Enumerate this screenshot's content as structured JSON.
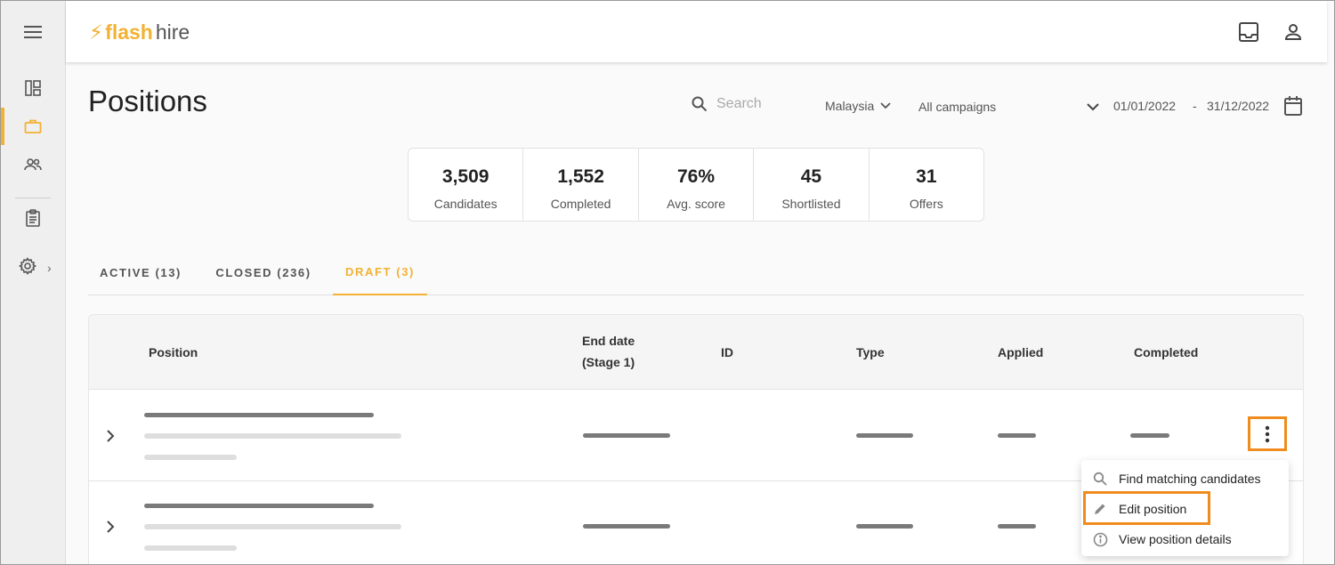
{
  "brand": {
    "bolt": "⚡",
    "flash": "flash",
    "hire": "hire",
    "accent": "#f2b233"
  },
  "sidebar": {
    "icons": [
      "menu-icon",
      "dashboard-icon",
      "briefcase-icon",
      "people-icon",
      "clipboard-icon",
      "gear-icon"
    ]
  },
  "topbar": {
    "icons": [
      "inbox-icon",
      "user-icon"
    ]
  },
  "page": {
    "title": "Positions"
  },
  "search": {
    "placeholder": "Search"
  },
  "filters": {
    "country": "Malaysia",
    "campaign": "All campaigns",
    "date_from": "01/01/2022",
    "date_separator": "-",
    "date_to": "31/12/2022"
  },
  "stats": [
    {
      "value": "3,509",
      "label": "Candidates"
    },
    {
      "value": "1,552",
      "label": "Completed"
    },
    {
      "value": "76%",
      "label": "Avg. score"
    },
    {
      "value": "45",
      "label": "Shortlisted"
    },
    {
      "value": "31",
      "label": "Offers"
    }
  ],
  "tabs": [
    {
      "label": "ACTIVE (13)"
    },
    {
      "label": "CLOSED (236)"
    },
    {
      "label": "DRAFT (3)"
    }
  ],
  "table": {
    "headers": {
      "position": "Position",
      "end_date_line1": "End date",
      "end_date_line2": "(Stage 1)",
      "id": "ID",
      "type": "Type",
      "applied": "Applied",
      "completed": "Completed"
    }
  },
  "context_menu": {
    "items": [
      {
        "label": "Find matching candidates",
        "icon": "search-icon"
      },
      {
        "label": "Edit position",
        "icon": "pencil-icon"
      },
      {
        "label": "View position details",
        "icon": "info-icon"
      }
    ]
  },
  "highlight_color": "#f08c1e"
}
